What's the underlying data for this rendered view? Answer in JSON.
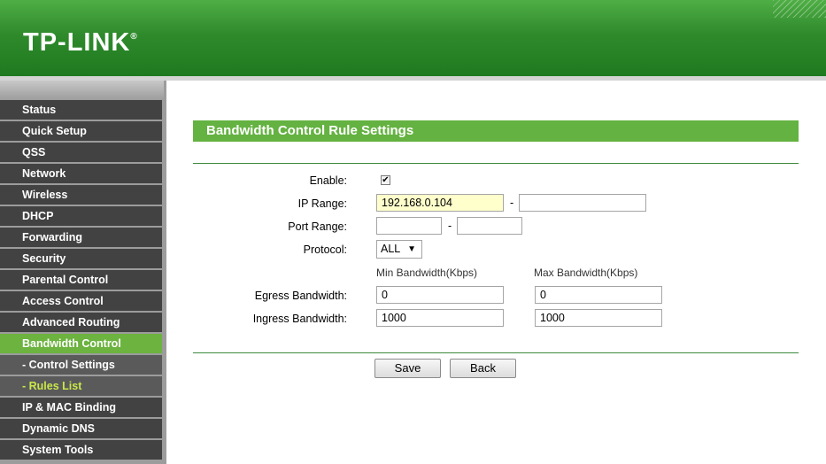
{
  "brand": {
    "logo_text": "TP-LINK",
    "logo_mark": "®"
  },
  "sidebar": {
    "items": [
      {
        "label": "Status"
      },
      {
        "label": "Quick Setup"
      },
      {
        "label": "QSS"
      },
      {
        "label": "Network"
      },
      {
        "label": "Wireless"
      },
      {
        "label": "DHCP"
      },
      {
        "label": "Forwarding"
      },
      {
        "label": "Security"
      },
      {
        "label": "Parental Control"
      },
      {
        "label": "Access Control"
      },
      {
        "label": "Advanced Routing"
      },
      {
        "label": "Bandwidth Control"
      },
      {
        "label": "- Control Settings"
      },
      {
        "label": "- Rules List"
      },
      {
        "label": "IP & MAC Binding"
      },
      {
        "label": "Dynamic DNS"
      },
      {
        "label": "System Tools"
      }
    ]
  },
  "main": {
    "title": "Bandwidth Control Rule Settings",
    "enable_label": "Enable:",
    "enable_checked": true,
    "ip_range_label": "IP Range:",
    "ip_start": "192.168.0.104",
    "ip_end": "",
    "port_range_label": "Port Range:",
    "port_start": "",
    "port_end": "",
    "dash": "-",
    "protocol_label": "Protocol:",
    "protocol_value": "ALL",
    "min_bw_header": "Min Bandwidth(Kbps)",
    "max_bw_header": "Max Bandwidth(Kbps)",
    "egress_label": "Egress Bandwidth:",
    "egress_min": "0",
    "egress_max": "0",
    "ingress_label": "Ingress Bandwidth:",
    "ingress_min": "1000",
    "ingress_max": "1000",
    "save_label": "Save",
    "back_label": "Back"
  },
  "colors": {
    "brand_green": "#2f8a2c",
    "title_green": "#64b241",
    "menu_active": "#6cb33f",
    "menu_bg": "#424242"
  }
}
